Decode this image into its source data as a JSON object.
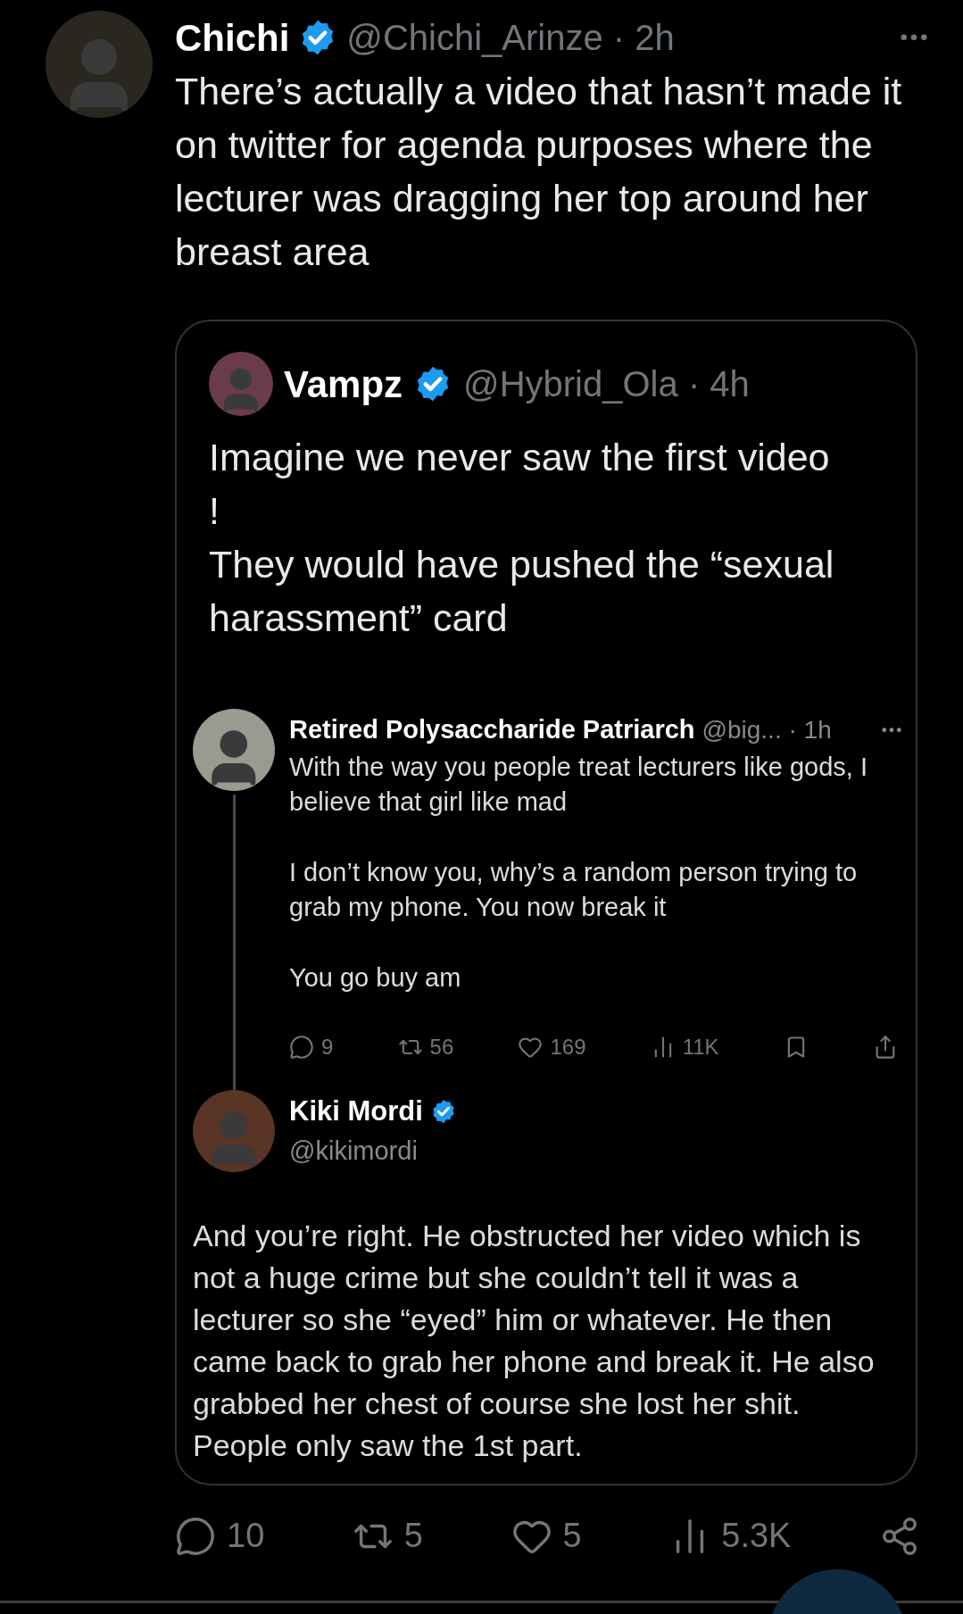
{
  "tweet": {
    "author": {
      "name": "Chichi",
      "verified": true,
      "handle": "@Chichi_Arinze",
      "time": "· 2h"
    },
    "text": "There’s actually a video that hasn’t made it on twitter for agenda purposes where the lecturer was dragging her top around her breast area",
    "quote": {
      "author": {
        "name": "Vampz",
        "verified": true,
        "handle": "@Hybrid_Ola",
        "time": "· 4h"
      },
      "text": "Imagine we never saw the first video\n!\nThey would have pushed the “sexual harassment” card",
      "screenshot": {
        "reply": {
          "name": "Retired Polysaccharide Patriarch",
          "handle": "@big...",
          "time": "· 1h",
          "paragraphs": [
            "With the way you people treat lecturers like gods, I believe that girl like mad",
            "I don’t know you, why’s a random person trying to grab my phone. You now break it",
            "You go buy am"
          ],
          "actions": [
            {
              "kind": "reply",
              "count": "9"
            },
            {
              "kind": "retweet",
              "count": "56"
            },
            {
              "kind": "like",
              "count": "169"
            },
            {
              "kind": "views",
              "count": "11K"
            },
            {
              "kind": "bookmark"
            },
            {
              "kind": "share"
            }
          ]
        },
        "reply_author": {
          "name": "Kiki Mordi",
          "verified": true,
          "handle": "@kikimordi"
        },
        "text": "And you’re right. He obstructed her video which is not a huge crime but she couldn’t tell it was a lecturer so she “eyed” him or whatever. He then came back to grab her phone and break it. He also grabbed her chest of course she lost her shit. People only saw the 1st part."
      }
    },
    "actions": [
      {
        "kind": "reply",
        "count": "10"
      },
      {
        "kind": "retweet",
        "count": "5"
      },
      {
        "kind": "like",
        "count": "5"
      },
      {
        "kind": "views",
        "count": "5.3K"
      },
      {
        "kind": "share_network"
      }
    ]
  }
}
